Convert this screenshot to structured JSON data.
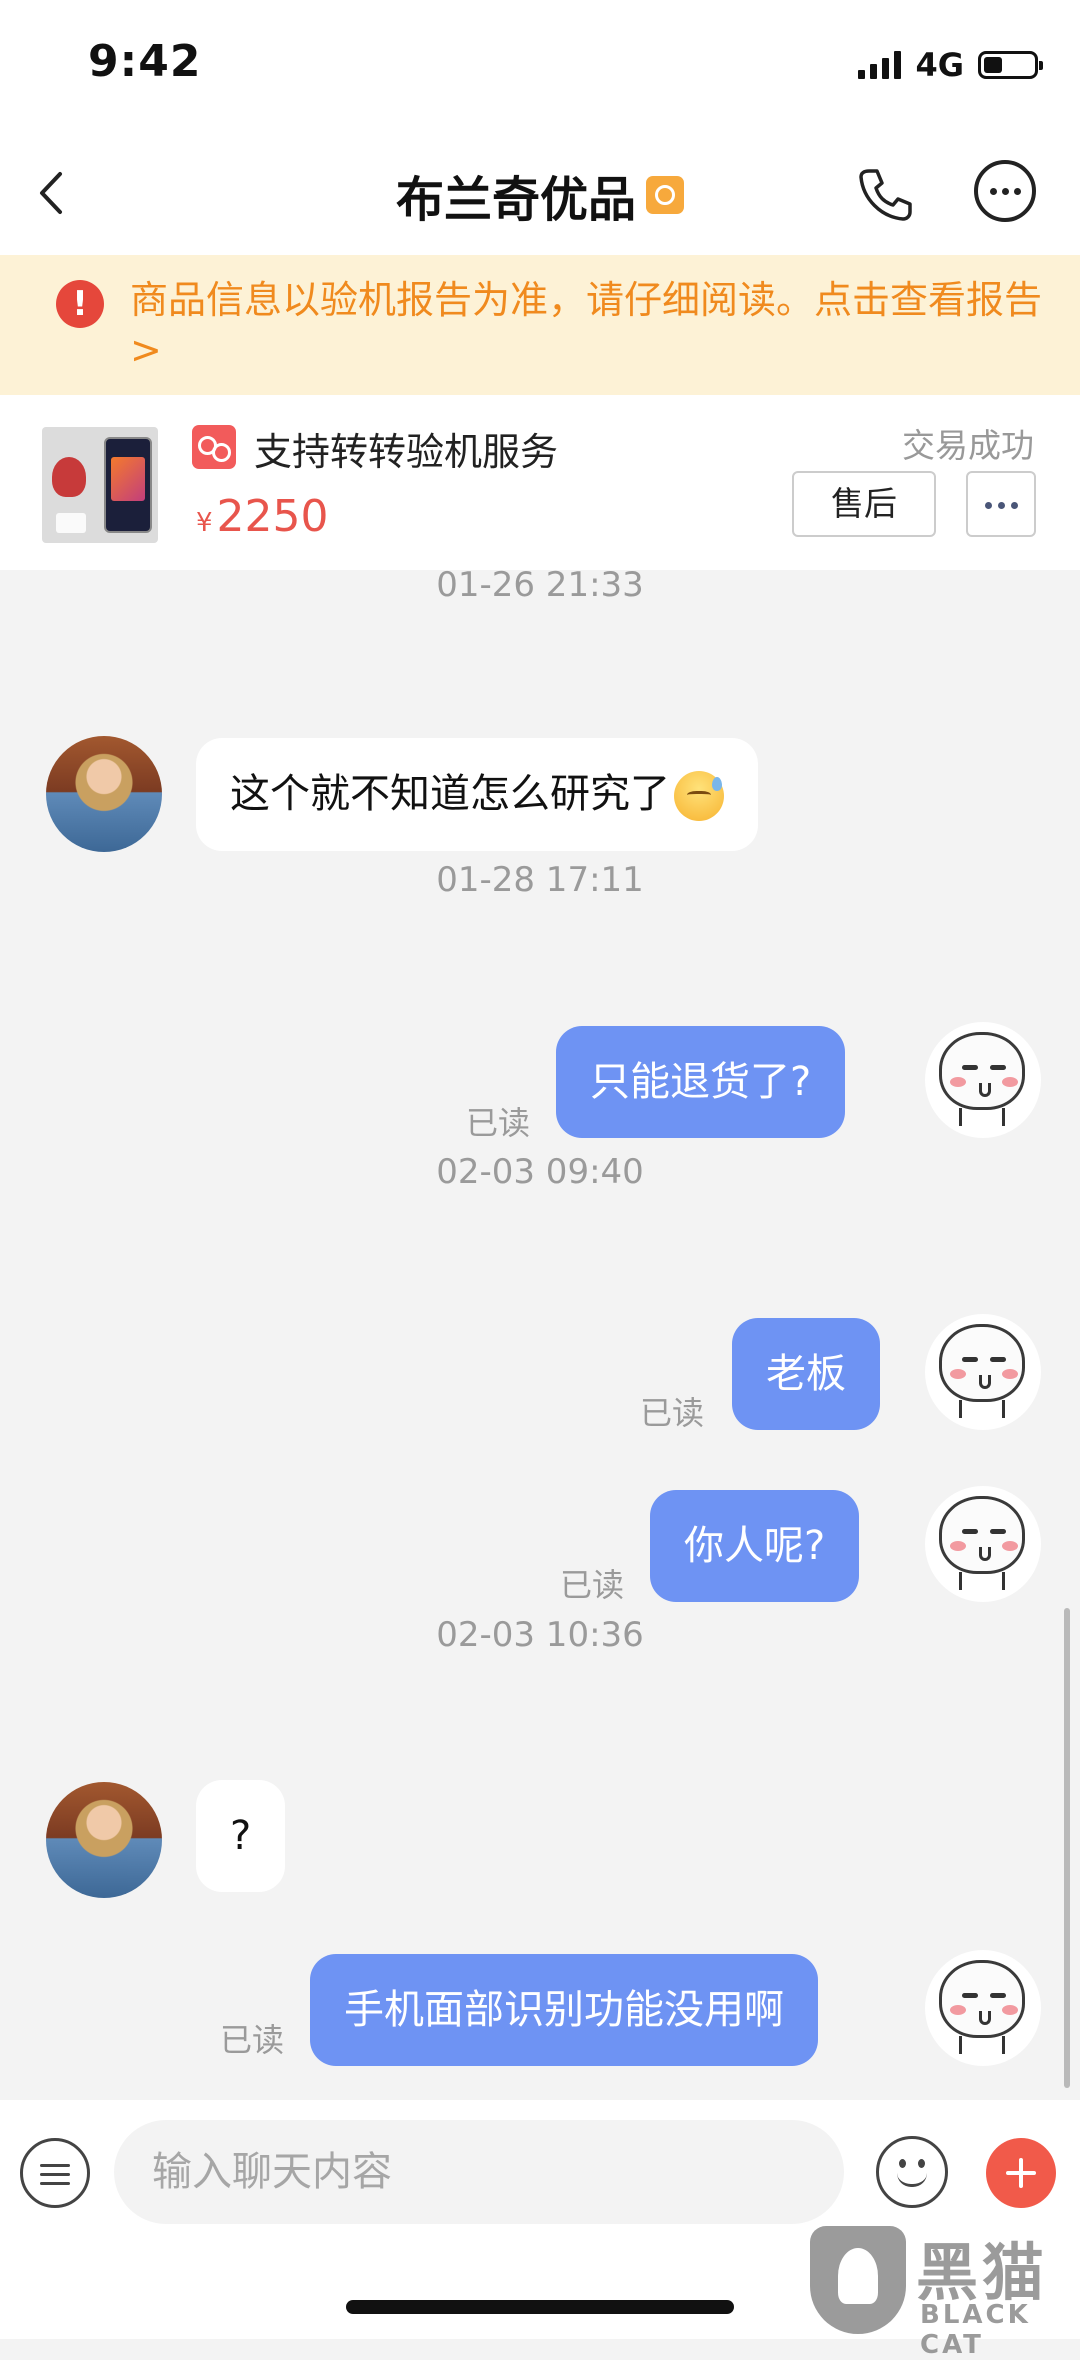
{
  "status_bar": {
    "time": "9:42",
    "network": "4G"
  },
  "nav": {
    "title": "布兰奇优品"
  },
  "notice": {
    "text": "商品信息以验机报告为准，请仔细阅读。点击查看报告>"
  },
  "product": {
    "service_label": "支持转转验机服务",
    "currency": "¥",
    "price": "2250",
    "status": "交易成功",
    "after_sale_label": "售后"
  },
  "chat": {
    "timestamps": [
      "01-26 21:33",
      "01-28 17:11",
      "02-03 09:40",
      "02-03 10:36"
    ],
    "read_label": "已读",
    "messages": [
      {
        "from": "other",
        "text": "这个就不知道怎么研究了"
      },
      {
        "from": "me",
        "text": "只能退货了?"
      },
      {
        "from": "me",
        "text": "老板"
      },
      {
        "from": "me",
        "text": "你人呢?"
      },
      {
        "from": "other",
        "text": "?"
      },
      {
        "from": "me",
        "text": "手机面部识别功能没用啊"
      }
    ]
  },
  "input": {
    "placeholder": "输入聊天内容"
  },
  "watermark": {
    "cn": "黑猫",
    "en": "BLACK CAT"
  },
  "colors": {
    "accent": "#6e93f3",
    "price": "#e8554c",
    "notice_text": "#f08a1e",
    "notice_bg": "#fdf2d6",
    "plus": "#f15a4a"
  },
  "icons": [
    "back-icon",
    "verified-badge-icon",
    "phone-icon",
    "more-icon",
    "alert-icon",
    "service-icon",
    "emoji-icon",
    "menu-icon",
    "plus-icon"
  ]
}
